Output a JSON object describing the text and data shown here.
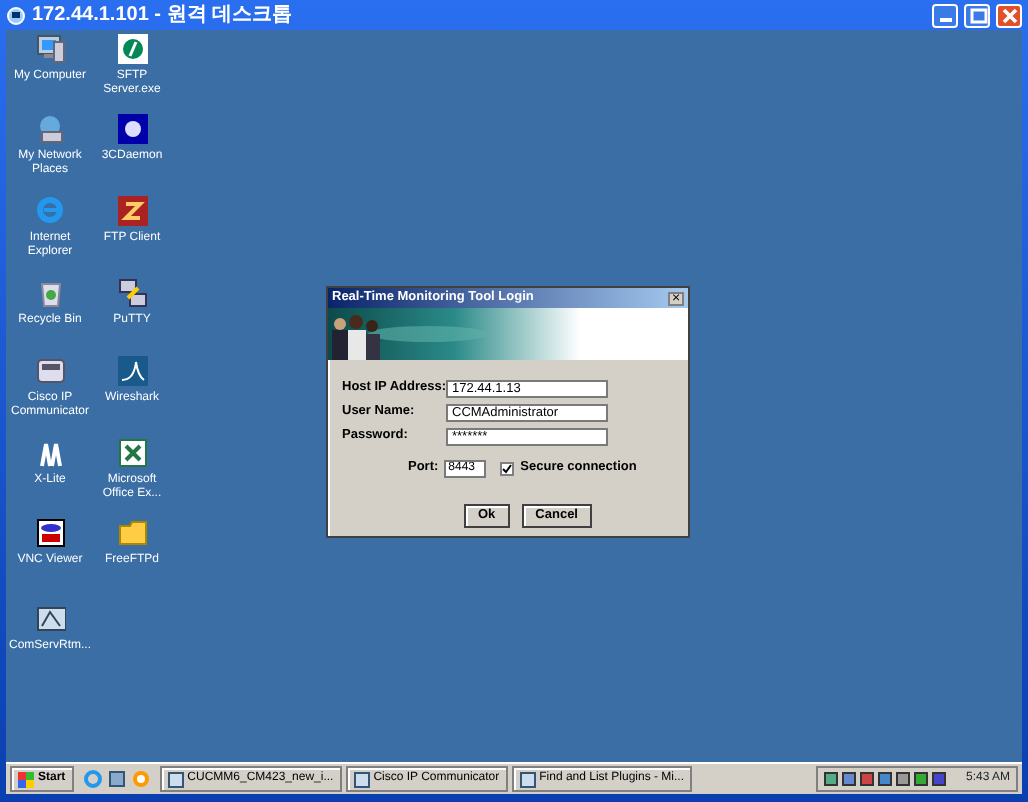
{
  "window": {
    "title": "172.44.1.101 - 원격 데스크톱"
  },
  "desktop_columns": [
    [
      {
        "kind": "computer",
        "label": "My Computer"
      },
      {
        "kind": "network",
        "label": "My Network Places"
      },
      {
        "kind": "browser",
        "label": "Internet Explorer"
      },
      {
        "kind": "bin",
        "label": "Recycle Bin"
      },
      {
        "kind": "phone",
        "label": "Cisco IP Communicator"
      },
      {
        "kind": "xlite",
        "label": "X-Lite"
      },
      {
        "kind": "vnc",
        "label": "VNC Viewer"
      },
      {
        "kind": "server",
        "label": "ComServRtm..."
      }
    ],
    [
      {
        "kind": "sftp",
        "label": "SFTP Server.exe"
      },
      {
        "kind": "cd",
        "label": "3CDaemon"
      },
      {
        "kind": "ftp",
        "label": "FTP Client"
      },
      {
        "kind": "putty",
        "label": "PuTTY"
      },
      {
        "kind": "shark",
        "label": "Wireshark"
      },
      {
        "kind": "excel",
        "label": "Microsoft Office Ex..."
      },
      {
        "kind": "folder",
        "label": "FreeFTPd"
      }
    ]
  ],
  "dialog": {
    "title": "Real-Time Monitoring Tool Login",
    "close": "×",
    "fields": [
      {
        "label": "Host IP Address:",
        "value": "172.44.1.13"
      },
      {
        "label": "User Name:",
        "value": "CCMAdministrator"
      },
      {
        "label": "Password:",
        "value": "*******"
      }
    ],
    "port": {
      "label": "Port:",
      "value": "8443"
    },
    "secure": {
      "label": "Secure connection",
      "checked": true
    },
    "buttons": [
      "Ok",
      "Cancel"
    ]
  },
  "taskbar": {
    "start": "Start",
    "tasks": [
      "CUCMM6_CM423_new_i...",
      "Cisco IP Communicator",
      "Find and List Plugins - Mi..."
    ],
    "clock": "5:43 AM"
  }
}
